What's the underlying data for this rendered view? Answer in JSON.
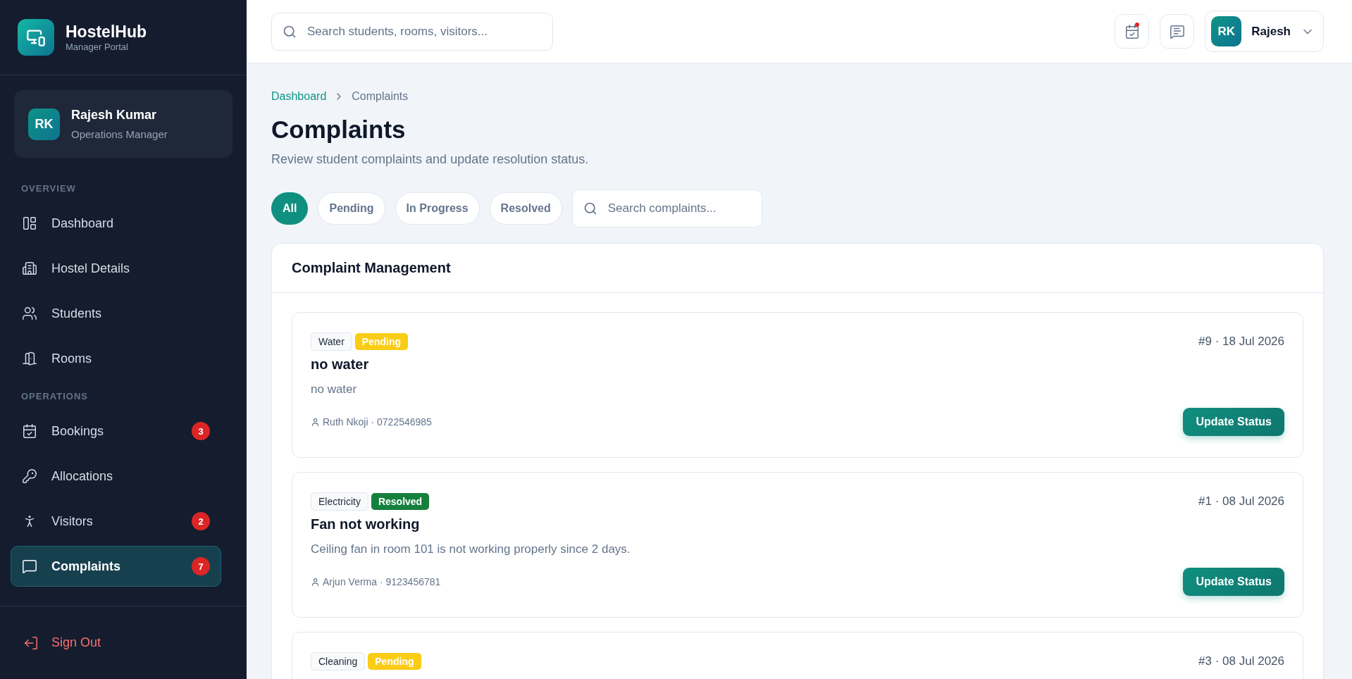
{
  "brand": {
    "name": "HostelHub",
    "subtitle": "Manager Portal"
  },
  "profile": {
    "initials": "RK",
    "name": "Rajesh Kumar",
    "role": "Operations Manager"
  },
  "nav_sections": [
    {
      "label": "OVERVIEW",
      "items": [
        {
          "kind": "dashboard",
          "label": "Dashboard",
          "selected": false
        },
        {
          "kind": "building",
          "label": "Hostel Details",
          "selected": false
        },
        {
          "kind": "users",
          "label": "Students",
          "selected": false
        },
        {
          "kind": "door",
          "label": "Rooms",
          "selected": false
        }
      ]
    },
    {
      "label": "OPERATIONS",
      "items": [
        {
          "kind": "calendar",
          "label": "Bookings",
          "badge": "3",
          "selected": false
        },
        {
          "kind": "key",
          "label": "Allocations",
          "selected": false
        },
        {
          "kind": "walker",
          "label": "Visitors",
          "badge": "2",
          "selected": false
        },
        {
          "kind": "message",
          "label": "Complaints",
          "badge": "7",
          "selected": true
        }
      ]
    }
  ],
  "sign_out": "Sign Out",
  "topbar": {
    "search_placeholder": "Search students, rooms, visitors...",
    "calendar_notification": true,
    "user": {
      "initials": "RK",
      "name": "Rajesh"
    }
  },
  "breadcrumb": [
    "Dashboard",
    "Complaints"
  ],
  "page": {
    "title": "Complaints",
    "subtitle": "Review student complaints and update resolution status."
  },
  "filters": [
    {
      "label": "All",
      "selected": true
    },
    {
      "label": "Pending",
      "selected": false
    },
    {
      "label": "In Progress",
      "selected": false
    },
    {
      "label": "Resolved",
      "selected": false
    }
  ],
  "filter_search_placeholder": "Search complaints...",
  "panel_title": "Complaint Management",
  "complaints": [
    {
      "category": "Water",
      "kind": "pending",
      "status_label": "Pending",
      "ref": "#9 · 18 Jul 2026",
      "title": "no water",
      "description": "no water",
      "reporter": "Ruth Nkoji · 0722546985",
      "action": "Update Status"
    },
    {
      "category": "Electricity",
      "kind": "resolved",
      "status_label": "Resolved",
      "ref": "#1 · 08 Jul 2026",
      "title": "Fan not working",
      "description": "Ceiling fan in room 101 is not working properly since 2 days.",
      "reporter": "Arjun Verma · 9123456781",
      "action": "Update Status"
    },
    {
      "category": "Cleaning",
      "kind": "pending",
      "status_label": "Pending",
      "ref": "#3 · 08 Jul 2026"
    }
  ]
}
